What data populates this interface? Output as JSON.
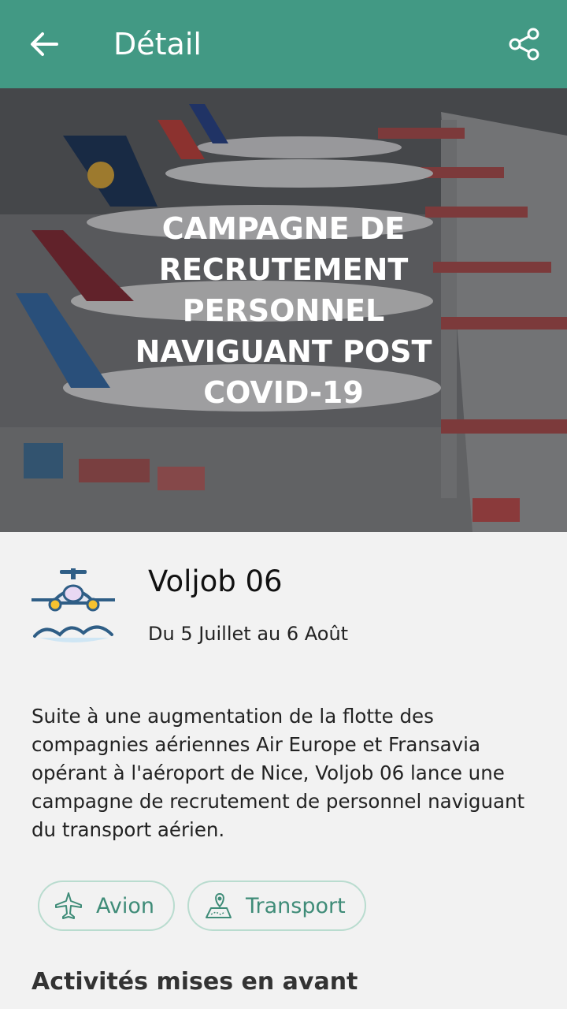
{
  "app_bar": {
    "title": "Détail",
    "back_icon": "arrow-left-icon",
    "share_icon": "share-icon",
    "background": "#429984"
  },
  "hero": {
    "title": "CAMPAGNE DE RECRUTEMENT PERSONNEL NAVIGUANT POST COVID-19"
  },
  "organizer": {
    "name": "Voljob 06",
    "dates": "Du 5 Juillet au 6 Août",
    "logo_icon": "airplane-clouds-logo-icon"
  },
  "description": "Suite à une augmentation de la flotte des compagnies aériennes Air Europe et Fransavia opérant à l'aéroport de Nice, Voljob 06 lance une campagne de recrutement de personnel naviguant du transport aérien.",
  "tags": [
    {
      "label": "Avion",
      "icon": "airplane-icon"
    },
    {
      "label": "Transport",
      "icon": "map-pin-icon"
    }
  ],
  "sections": {
    "highlighted_activities": "Activités mises en avant"
  }
}
